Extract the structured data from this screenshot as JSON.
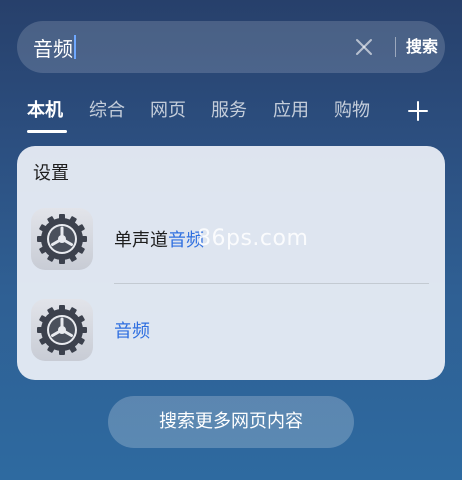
{
  "search": {
    "query": "音频",
    "submit_label": "搜索",
    "clear_icon": "close-icon"
  },
  "tabs": [
    {
      "label": "本机",
      "active": true
    },
    {
      "label": "综合",
      "active": false
    },
    {
      "label": "网页",
      "active": false
    },
    {
      "label": "服务",
      "active": false
    },
    {
      "label": "应用",
      "active": false
    },
    {
      "label": "购物",
      "active": false
    }
  ],
  "add_tab_icon": "plus-icon",
  "results_card": {
    "title": "设置",
    "items": [
      {
        "prefix": "单声道",
        "highlight": "音频",
        "icon": "settings-gear-icon"
      },
      {
        "prefix": "",
        "highlight": "音频",
        "icon": "settings-gear-icon"
      }
    ]
  },
  "watermark": "86ps.com",
  "more_button": "搜索更多网页内容",
  "colors": {
    "highlight": "#2f6fe0",
    "background_top": "#27406b",
    "background_bottom": "#2e6aa0",
    "card": "#ecf0f7"
  }
}
